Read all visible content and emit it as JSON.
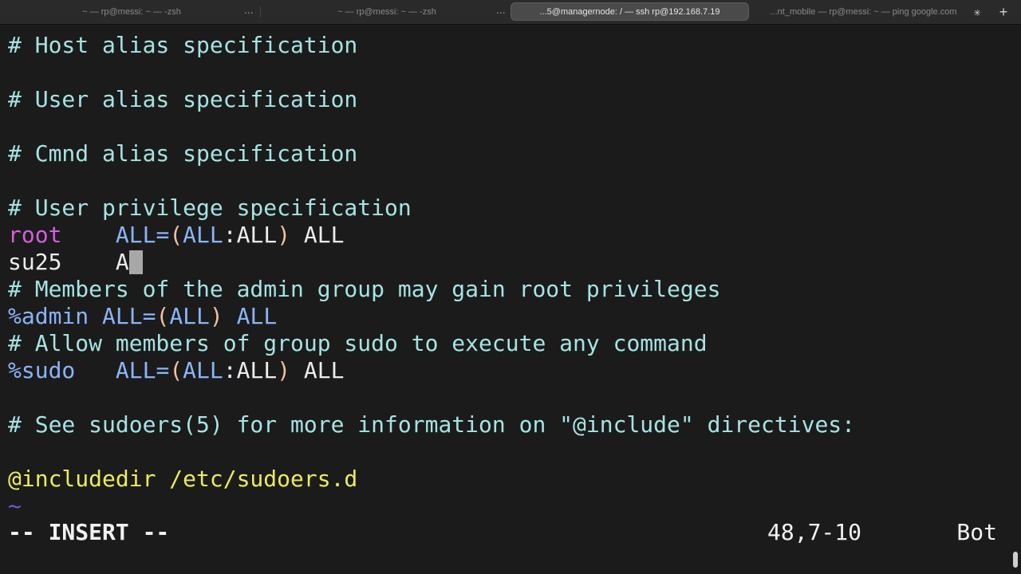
{
  "tabs": [
    {
      "title": "~ — rp@messi: ~ — -zsh",
      "active": false
    },
    {
      "title": "~ — rp@messi: ~ — -zsh",
      "active": false
    },
    {
      "title": "...5@managernode: / — ssh rp@192.168.7.19",
      "active": true
    },
    {
      "title": "...nt_mobile — rp@messi: ~ — ping google.com",
      "active": false
    }
  ],
  "tab_more_glyph": "...",
  "new_tab_label": "+",
  "editor": {
    "comment_host": "# Host alias specification",
    "comment_user": "# User alias specification",
    "comment_cmnd": "# Cmnd alias specification",
    "comment_priv": "# User privilege specification",
    "root_user": "root",
    "root_pad": "    ",
    "root_all1": "ALL=",
    "root_open": "(",
    "root_all2": "ALL",
    "root_colon": ":ALL",
    "root_close": ")",
    "root_all3": " ALL",
    "su_line": "su25    A",
    "comment_admin": "# Members of the admin group may gain root privileges",
    "admin_group": "%admin",
    "admin_all1": " ALL=",
    "admin_open": "(",
    "admin_all2": "ALL",
    "admin_close": ")",
    "admin_all3": " ALL",
    "comment_sudo": "# Allow members of group sudo to execute any command",
    "sudo_group": "%sudo",
    "sudo_pad": "   ",
    "sudo_all1": "ALL=",
    "sudo_open": "(",
    "sudo_all2": "ALL",
    "sudo_colon": ":ALL",
    "sudo_close": ")",
    "sudo_all3": " ALL",
    "comment_include": "# See sudoers(5) for more information on \"@include\" directives:",
    "includedir": "@includedir /etc/sudoers.d",
    "tilde": "~"
  },
  "statusline": {
    "mode": "-- INSERT --",
    "position": "48,7-10",
    "scroll": "Bot"
  },
  "colors": {
    "background": "#1b1b1b",
    "comment": "#a6e3e3",
    "keyword": "#d55fde",
    "identifier": "#8ab4f8",
    "directive": "#ecec5a"
  }
}
